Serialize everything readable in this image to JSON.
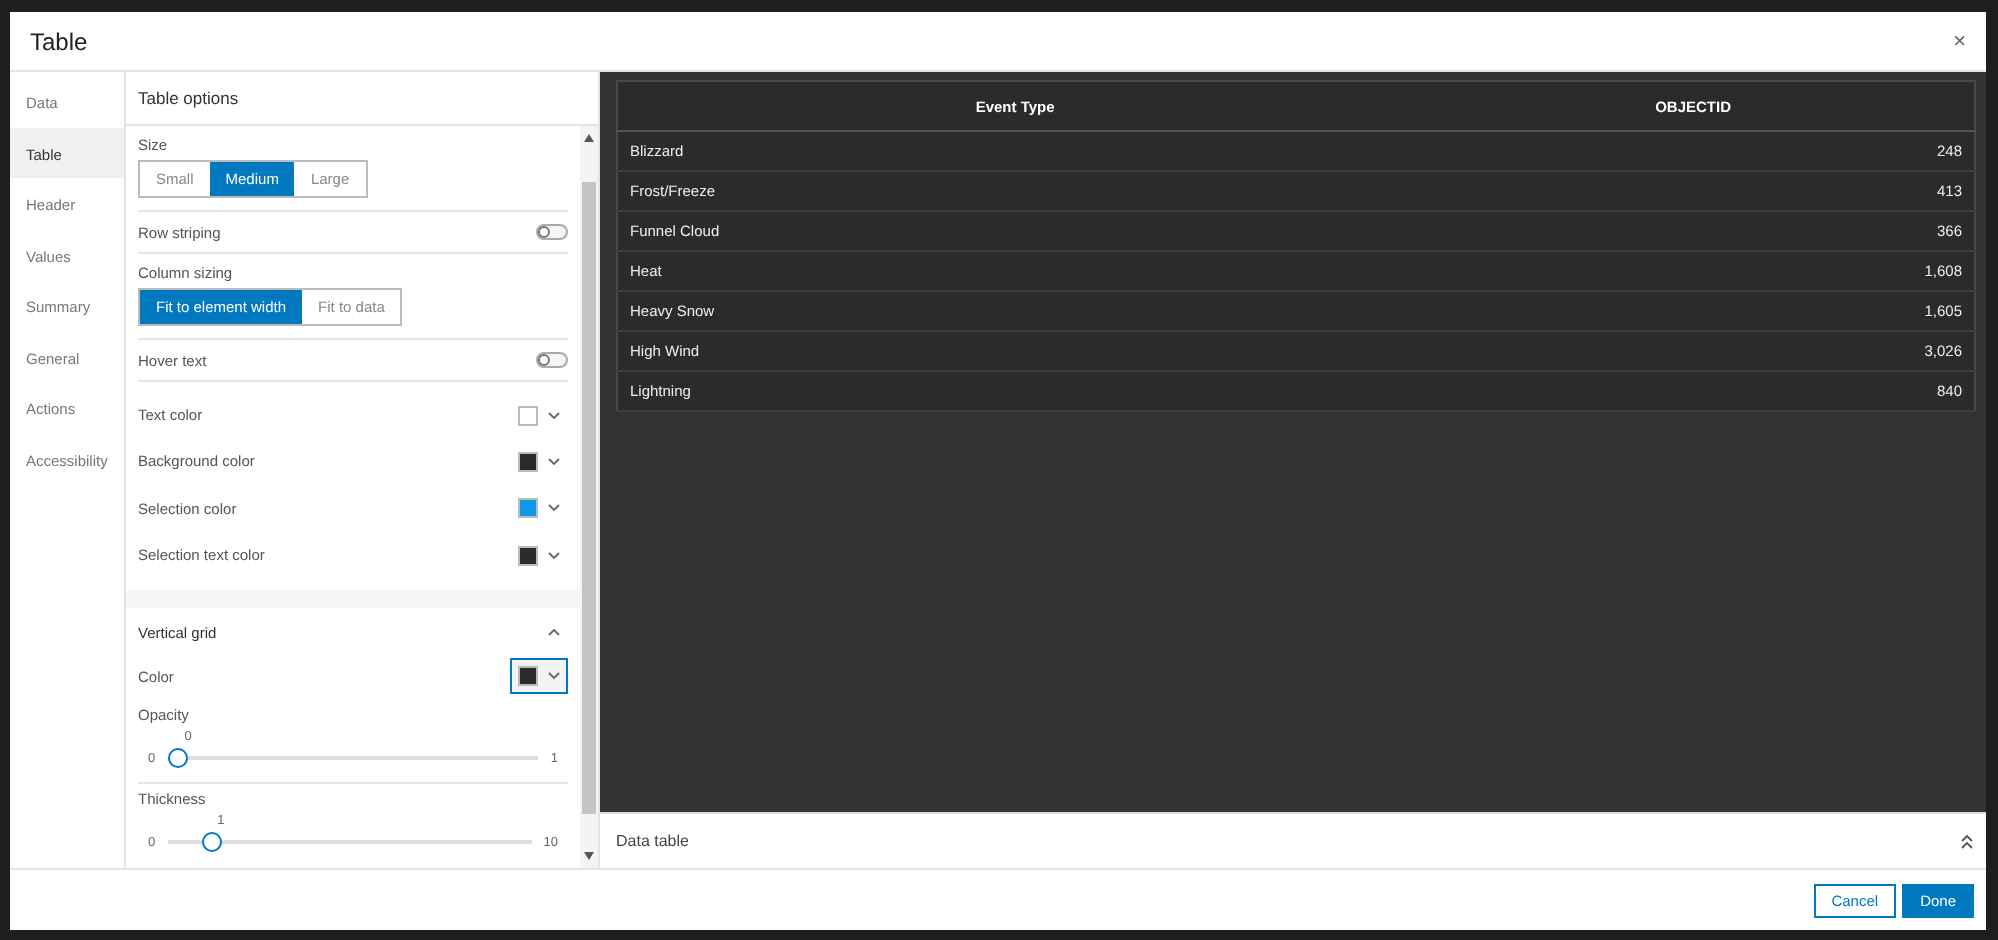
{
  "dialog": {
    "title": "Table",
    "close": "×"
  },
  "sidebar": {
    "items": [
      {
        "label": "Data",
        "selected": false
      },
      {
        "label": "Table",
        "selected": true
      },
      {
        "label": "Header",
        "selected": false
      },
      {
        "label": "Values",
        "selected": false
      },
      {
        "label": "Summary",
        "selected": false
      },
      {
        "label": "General",
        "selected": false
      },
      {
        "label": "Actions",
        "selected": false
      },
      {
        "label": "Accessibility",
        "selected": false
      }
    ]
  },
  "options": {
    "title": "Table options",
    "size": {
      "label": "Size",
      "options": [
        {
          "label": "Small",
          "selected": false
        },
        {
          "label": "Medium",
          "selected": true
        },
        {
          "label": "Large",
          "selected": false
        }
      ]
    },
    "row_striping": {
      "label": "Row striping",
      "on": false
    },
    "column_sizing": {
      "label": "Column sizing",
      "options": [
        {
          "label": "Fit to element width",
          "selected": true
        },
        {
          "label": "Fit to data",
          "selected": false
        }
      ]
    },
    "hover_text": {
      "label": "Hover text",
      "on": false
    },
    "colors": [
      {
        "label": "Text color",
        "color": "#ffffff"
      },
      {
        "label": "Background color",
        "color": "#2b2b2b"
      },
      {
        "label": "Selection color",
        "color": "#0d99e8"
      },
      {
        "label": "Selection text color",
        "color": "#2b2b2b"
      }
    ],
    "vertical_grid": {
      "title": "Vertical grid",
      "expanded": true,
      "color": {
        "label": "Color",
        "color": "#2b2b2b"
      },
      "opacity": {
        "label": "Opacity",
        "value": "0",
        "min": "0",
        "max": "1",
        "level": 0
      },
      "thickness": {
        "label": "Thickness",
        "value": "1",
        "min": "0",
        "max": "10",
        "level": 0.1
      }
    }
  },
  "preview": {
    "table": {
      "columns": [
        "Event Type",
        "OBJECTID"
      ],
      "rows": [
        [
          "Blizzard",
          "248"
        ],
        [
          "Frost/Freeze",
          "413"
        ],
        [
          "Funnel Cloud",
          "366"
        ],
        [
          "Heat",
          "1,608"
        ],
        [
          "Heavy Snow",
          "1,605"
        ],
        [
          "High Wind",
          "3,026"
        ],
        [
          "Lightning",
          "840"
        ]
      ]
    },
    "panel": {
      "title": "Data table",
      "expanded": false
    }
  },
  "buttons": [
    {
      "label": "Cancel",
      "kind": "secondary"
    },
    {
      "label": "Done",
      "kind": "primary"
    }
  ]
}
